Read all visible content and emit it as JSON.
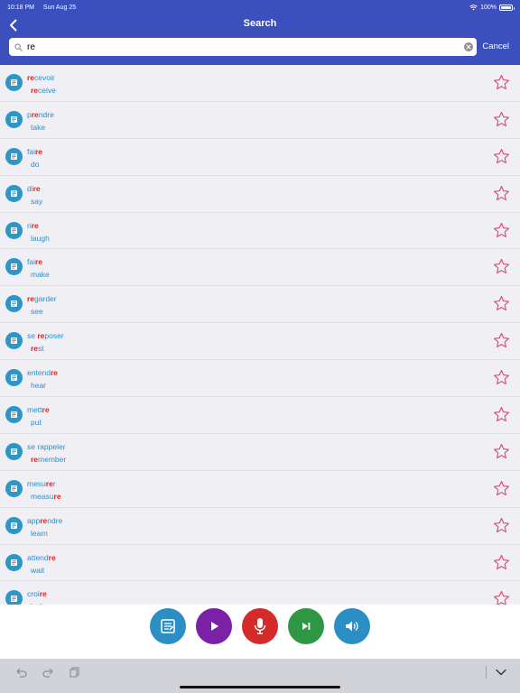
{
  "status_bar": {
    "time": "10:18 PM",
    "date": "Sun Aug 25",
    "battery": "100%",
    "battery_level": 1.0
  },
  "header": {
    "title": "Search",
    "back_icon": "chevron-left-icon"
  },
  "search": {
    "value": "re",
    "placeholder": "",
    "cancel_label": "Cancel"
  },
  "colors": {
    "header": "#3b4fbd",
    "word": "#2a8fcb",
    "highlight": "#e41e1e",
    "star": "#d9486e"
  },
  "results": [
    {
      "word": [
        [
          "",
          "re"
        ],
        [
          "cevoir",
          ""
        ]
      ],
      "trans": [
        [
          "",
          "re"
        ],
        [
          "ceive",
          ""
        ]
      ]
    },
    {
      "word": [
        [
          "p",
          "re"
        ],
        [
          "ndre",
          ""
        ]
      ],
      "trans": [
        [
          "take",
          ""
        ]
      ]
    },
    {
      "word": [
        [
          "fai",
          "re"
        ]
      ],
      "trans": [
        [
          "do",
          ""
        ]
      ]
    },
    {
      "word": [
        [
          "di",
          "re"
        ]
      ],
      "trans": [
        [
          "say",
          ""
        ]
      ]
    },
    {
      "word": [
        [
          "ri",
          "re"
        ]
      ],
      "trans": [
        [
          "laugh",
          ""
        ]
      ]
    },
    {
      "word": [
        [
          "fai",
          "re"
        ]
      ],
      "trans": [
        [
          "make",
          ""
        ]
      ]
    },
    {
      "word": [
        [
          "",
          "re"
        ],
        [
          "garder",
          ""
        ]
      ],
      "trans": [
        [
          "see",
          ""
        ]
      ]
    },
    {
      "word": [
        [
          "se ",
          "re"
        ],
        [
          "poser",
          ""
        ]
      ],
      "trans": [
        [
          "",
          "re"
        ],
        [
          "st",
          ""
        ]
      ]
    },
    {
      "word": [
        [
          "entend",
          "re"
        ]
      ],
      "trans": [
        [
          "hear",
          ""
        ]
      ]
    },
    {
      "word": [
        [
          "mett",
          "re"
        ]
      ],
      "trans": [
        [
          "put",
          ""
        ]
      ]
    },
    {
      "word": [
        [
          "se rappeler",
          ""
        ]
      ],
      "trans": [
        [
          "",
          "re"
        ],
        [
          "member",
          ""
        ]
      ]
    },
    {
      "word": [
        [
          "mesu",
          "re"
        ],
        [
          "r",
          ""
        ]
      ],
      "trans": [
        [
          "measu",
          "re"
        ]
      ]
    },
    {
      "word": [
        [
          "app",
          "re"
        ],
        [
          "ndre",
          ""
        ]
      ],
      "trans": [
        [
          "learn",
          ""
        ]
      ]
    },
    {
      "word": [
        [
          "attend",
          "re"
        ]
      ],
      "trans": [
        [
          "wait",
          ""
        ]
      ]
    },
    {
      "word": [
        [
          "croi",
          "re"
        ]
      ],
      "trans": [
        [
          "believe",
          ""
        ]
      ]
    }
  ],
  "actions": [
    {
      "name": "notes-button",
      "icon": "notes-icon",
      "color": "#2b8fc3"
    },
    {
      "name": "play-button",
      "icon": "play-icon",
      "color": "#7b21a8"
    },
    {
      "name": "microphone-button",
      "icon": "microphone-icon",
      "color": "#d42a2a"
    },
    {
      "name": "next-button",
      "icon": "skip-next-icon",
      "color": "#2f9645"
    },
    {
      "name": "speaker-button",
      "icon": "speaker-icon",
      "color": "#2b8fc3"
    }
  ],
  "keyboard_bar": {
    "icons": [
      "undo-icon",
      "redo-icon",
      "paste-icon",
      "hide-keyboard-icon"
    ]
  }
}
